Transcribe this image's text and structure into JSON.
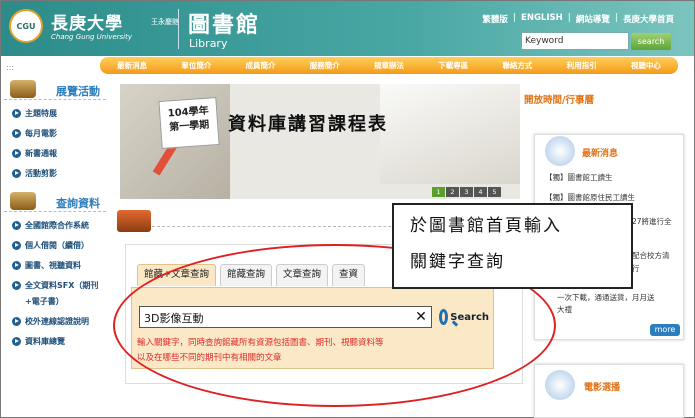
{
  "header": {
    "logo_text": "CGU",
    "university_zh": "長庚大學",
    "university_sub": "王永慶館",
    "university_en": "Chang Gung University",
    "library_zh": "圖書館",
    "library_en": "Library",
    "top_links": [
      "繁體版",
      "ENGLISH",
      "網站導覽",
      "長庚大學首頁"
    ],
    "search_placeholder": "Keyword",
    "search_button": "search"
  },
  "nav": [
    "最新消息",
    "單位簡介",
    "成員簡介",
    "服務簡介",
    "規章辦法",
    "下載專區",
    "聯絡方式",
    "利用指引",
    "視聽中心"
  ],
  "sidebar": {
    "dots": ":::",
    "section1_title": "展覽活動",
    "section1_items": [
      "主題特展",
      "每月電影",
      "新書通報",
      "活動剪影"
    ],
    "section2_title": "查詢資料",
    "section2_items": [
      "全國館際合作系統",
      "個人借閱（續借）",
      "圖書、視聽資料",
      "全文資料SFX（期刊+電子書）",
      "校外連線認證說明",
      "資料庫總覽"
    ]
  },
  "banner": {
    "calendar_line1": "104學年",
    "calendar_line2": "第一學期",
    "title": "資料庫講習課程表",
    "pages": [
      "1",
      "2",
      "3",
      "4",
      "5"
    ]
  },
  "right": {
    "open_hours": "開放時間/行事曆",
    "news_title": "最新消息",
    "news_items": [
      "【獨】圖書館工讀生",
      "【獨】圖書館原住民工讀生"
    ],
    "news_behind": [
      "27將進行全",
      "配合校方清",
      "行",
      "一次下載，通通送貨，月月送",
      "大禮"
    ],
    "more": "more",
    "movie_title": "電影選播"
  },
  "search": {
    "tabs": [
      "館藏+文章查詢",
      "館藏查詢",
      "文章查詢",
      "查資"
    ],
    "active_tab": 0,
    "query": "3D影像互動",
    "clear": "✕",
    "button": "Search",
    "hint_line1": "輸入關鍵字，同時查詢館藏所有資源包括圖書、期刊、視聽資料等",
    "hint_line2": "以及在哪些不同的期刊中有相關的文章"
  },
  "callout": {
    "line1": "於圖書館首頁輸入",
    "line2": "關鍵字查詢"
  },
  "colors": {
    "accent_orange": "#f39a1a",
    "header_teal": "#2b8c8a",
    "annotation_red": "#e02020"
  }
}
